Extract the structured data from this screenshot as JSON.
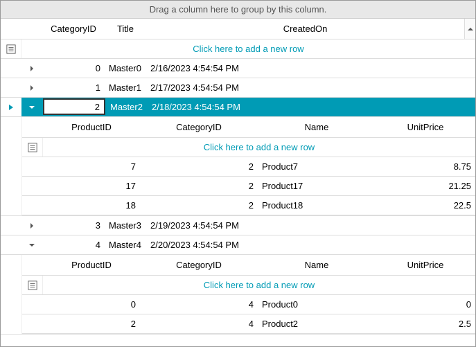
{
  "group_panel_text": "Drag a column here to group by this column.",
  "addrow_text": "Click here to add a new row",
  "columns": {
    "category_id": "CategoryID",
    "title": "Title",
    "created_on": "CreatedOn"
  },
  "child_columns": {
    "product_id": "ProductID",
    "category_id": "CategoryID",
    "name": "Name",
    "unit_price": "UnitPrice"
  },
  "rows": [
    {
      "expanded": false,
      "selected": false,
      "category_id": "0",
      "title": "Master0",
      "created_on": "2/16/2023 4:54:54 PM"
    },
    {
      "expanded": false,
      "selected": false,
      "category_id": "1",
      "title": "Master1",
      "created_on": "2/17/2023 4:54:54 PM"
    },
    {
      "expanded": true,
      "selected": true,
      "category_id": "2",
      "title": "Master2",
      "created_on": "2/18/2023 4:54:54 PM",
      "children": [
        {
          "product_id": "7",
          "category_id": "2",
          "name": "Product7",
          "unit_price": "8.75"
        },
        {
          "product_id": "17",
          "category_id": "2",
          "name": "Product17",
          "unit_price": "21.25"
        },
        {
          "product_id": "18",
          "category_id": "2",
          "name": "Product18",
          "unit_price": "22.5"
        }
      ]
    },
    {
      "expanded": false,
      "selected": false,
      "category_id": "3",
      "title": "Master3",
      "created_on": "2/19/2023 4:54:54 PM"
    },
    {
      "expanded": true,
      "selected": false,
      "category_id": "4",
      "title": "Master4",
      "created_on": "2/20/2023 4:54:54 PM",
      "children": [
        {
          "product_id": "0",
          "category_id": "4",
          "name": "Product0",
          "unit_price": "0"
        },
        {
          "product_id": "2",
          "category_id": "4",
          "name": "Product2",
          "unit_price": "2.5"
        }
      ]
    }
  ],
  "colors": {
    "accent": "#009bb5"
  }
}
